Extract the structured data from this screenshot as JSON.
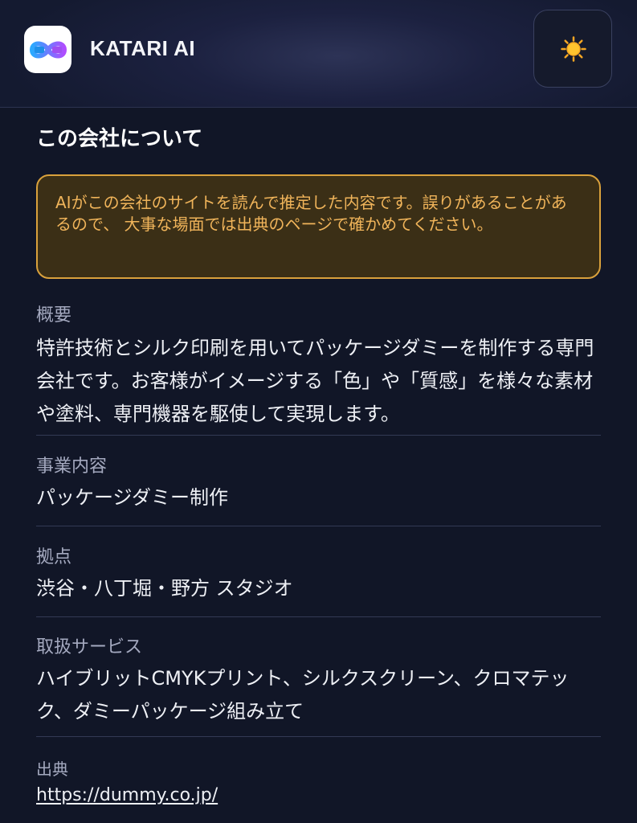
{
  "header": {
    "app_title": "KATARI AI",
    "logo_icon": "infinity-logo-icon",
    "theme_toggle_icon": "sun-icon"
  },
  "section": {
    "title": "この会社について",
    "notice": "AIがこの会社のサイトを読んで推定した内容です。誤りがあることがあるので、 大事な場面では出典のページで確かめてください。"
  },
  "fields": {
    "overview": {
      "label": "概要",
      "value": "特許技術とシルク印刷を用いてパッケージダミーを制作する専門会社です。お客様がイメージする「色」や「質感」を様々な素材や塗料、専門機器を駆使して実現します。"
    },
    "business": {
      "label": "事業内容",
      "value": "パッケージダミー制作"
    },
    "locations": {
      "label": "拠点",
      "value": "渋谷・八丁堀・野方 スタジオ"
    },
    "services": {
      "label": "取扱サービス",
      "value": "ハイブリットCMYKプリント、シルクスクリーン、クロマテック、ダミーパッケージ組み立て"
    },
    "source": {
      "label": "出典",
      "url": "https://dummy.co.jp/"
    }
  },
  "colors": {
    "background": "#111627",
    "notice_border": "#d9a13c",
    "notice_text": "#f0b45a",
    "label_text": "#a4a9bf"
  }
}
